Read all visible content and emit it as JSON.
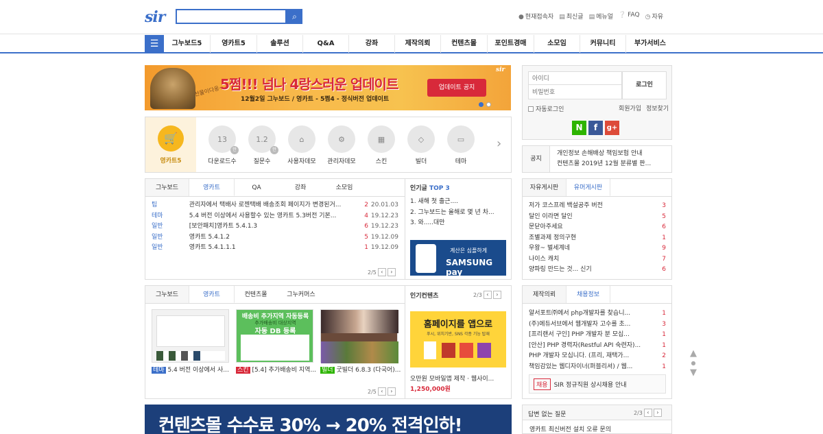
{
  "header": {
    "logo": "sir",
    "search_placeholder": "",
    "toplinks": [
      {
        "icon": "user-icon",
        "label": "현재접속자"
      },
      {
        "icon": "doc-icon",
        "label": "최신글"
      },
      {
        "icon": "book-icon",
        "label": "메뉴얼"
      },
      {
        "icon": "question-icon",
        "label": "FAQ"
      },
      {
        "icon": "clock-icon",
        "label": "자유"
      }
    ]
  },
  "nav": {
    "items": [
      "그누보드5",
      "영카트5",
      "솔루션",
      "Q&A",
      "강좌",
      "제작의뢰",
      "컨텐츠몰",
      "포인트경매",
      "소모임",
      "커뮤니티",
      "부가서비스"
    ]
  },
  "banner": {
    "title": "5쩜!!! 넘나 4랑스러운 업데이트",
    "subtitle": "12월2일 그누보드 / 영카트 - 5쩜4 - 정식버전 업데이트",
    "button": "업데이트 공지",
    "cat_caption": "선물이다옹~"
  },
  "icons": {
    "main_label": "영카트5",
    "items": [
      {
        "label": "다운로드수",
        "value": "13",
        "badge": "만"
      },
      {
        "label": "질문수",
        "value": "1.2",
        "badge": "만"
      },
      {
        "label": "사용자데모",
        "icon": "home-icon"
      },
      {
        "label": "관리자데모",
        "icon": "gear-icon"
      },
      {
        "label": "스킨",
        "icon": "map-icon"
      },
      {
        "label": "빌더",
        "icon": "layers-icon"
      },
      {
        "label": "테마",
        "icon": "folder-icon"
      }
    ]
  },
  "board1": {
    "tabs": [
      "그누보드",
      "영카트",
      "QA",
      "강좌",
      "소모임"
    ],
    "active": 1,
    "rows": [
      {
        "cat": "팁",
        "subject": "관리자에서 택배사 로젠택배 배송조회 페이지가 변경된거...",
        "count": "2",
        "date": "20.01.03"
      },
      {
        "cat": "테마",
        "subject": "5.4 버전 이상에서 사용할수 있는 영카트 5.3버전 기본...",
        "count": "4",
        "date": "19.12.23"
      },
      {
        "cat": "일반",
        "subject": "[보안패치]영카트 5.4.1.3",
        "count": "6",
        "date": "19.12.23"
      },
      {
        "cat": "일반",
        "subject": "영카트 5.4.1.2",
        "count": "5",
        "date": "19.12.09"
      },
      {
        "cat": "일반",
        "subject": "영카트 5.4.1.1.1",
        "count": "1",
        "date": "19.12.09"
      }
    ],
    "page": "2/5"
  },
  "popular": {
    "title": "인기글",
    "title_accent": "TOP 3",
    "rows": [
      "1. 새해 첫 출근....",
      "2. 그누보드는 올해로 몇 년 차...",
      "3. 와.....대만"
    ],
    "ad_text": "계산은 심플하게",
    "ad_brand": "SAMSUNG pay"
  },
  "board2": {
    "tabs": [
      "그누보드",
      "영카트",
      "컨텐츠몰",
      "그누커머스"
    ],
    "active": 1,
    "items": [
      {
        "tag": "테마",
        "subject": "5.4 버전 이상에서 사..."
      },
      {
        "tag": "스킨",
        "subject": "[5.4] 추가배송비 지역..."
      },
      {
        "tag": "빌더",
        "subject": "굿빌더 6.8.3 (다국어)..."
      }
    ],
    "thumb2_title": "배송비 추가지역 자동등록",
    "thumb2_sub": "추가배송비 대상지역",
    "thumb2_big": "자동 DB 등록",
    "page": "2/5"
  },
  "contents": {
    "title": "인기컨텐츠",
    "page": "2/3",
    "ad_title": "홈페이지를 앱으로",
    "ad_sub": "푸시, 위치기반, SNS 각종 기능 탑재",
    "caption": "오만원 모바일앱 제작 · 웹사이...",
    "price": "1,250,000원"
  },
  "banner2": {
    "text": "컨텐츠몰 수수료 30% → 20% 전격인하!"
  },
  "login": {
    "id_placeholder": "아이디",
    "pw_placeholder": "비밀번호",
    "button": "로그인",
    "auto_login": "자동로그인",
    "join": "회원가입",
    "find": "정보찾기"
  },
  "notice": {
    "label": "공지",
    "lines": [
      "개인정보 손해배상 책임보험 안내",
      "컨텐츠몰 2019년 12월 분류별 판..."
    ]
  },
  "free": {
    "tabs": [
      "자유게시판",
      "유머게시판"
    ],
    "active": 1,
    "rows": [
      {
        "subject": "저가 코스프레 백설공주 버전",
        "count": "3"
      },
      {
        "subject": "달인 이라면 달인",
        "count": "5"
      },
      {
        "subject": "문닫아주세요",
        "count": "6"
      },
      {
        "subject": "조별과제 정의구현",
        "count": "1"
      },
      {
        "subject": "우왕~ 벌세계네",
        "count": "9"
      },
      {
        "subject": "나이스 캐치",
        "count": "7"
      },
      {
        "subject": "양파링 만드는 것... 신기",
        "count": "6"
      }
    ]
  },
  "jobs": {
    "tabs": [
      "제작의뢰",
      "채용정보"
    ],
    "active": 1,
    "rows": [
      {
        "subject": "알서포트㈜에서 php개발자를 찾습니...",
        "count": "1"
      },
      {
        "subject": "(주)에듀서브에서 웹개발자 고수를 초...",
        "count": "3"
      },
      {
        "subject": "[프리랜서 구인] PHP 개발자 분 모십...",
        "count": "1"
      },
      {
        "subject": "[안산] PHP 경력자(Restful API 숙련자)...",
        "count": "1"
      },
      {
        "subject": "PHP 개발자 모십니다. (프리, 재택가...",
        "count": "2"
      },
      {
        "subject": "책임감있는 웹디자이너(퍼블리셔) / 웹...",
        "count": "1"
      }
    ],
    "recruit_tag": "채용",
    "recruit_text": "SIR 정규직원 상시채용 안내"
  },
  "unanswered": {
    "title": "답변 없는 질문",
    "page": "2/3",
    "first": "영카트 최신버전 설치 오류 문의"
  },
  "colors": {
    "accent": "#3b6fc9",
    "red": "#d8293a",
    "naver": "#2db400",
    "facebook": "#3b5998",
    "google": "#dd4b39"
  }
}
